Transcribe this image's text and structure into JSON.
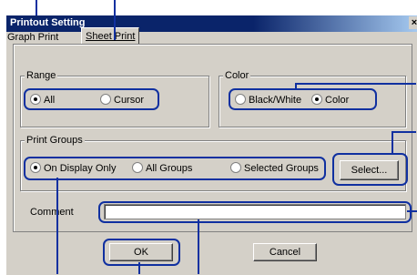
{
  "dialog": {
    "title": "Printout Setting"
  },
  "tabs": [
    {
      "label": "Graph Print"
    },
    {
      "label": "Sheet Print"
    }
  ],
  "range": {
    "legend": "Range",
    "options": [
      {
        "label": "All",
        "selected": true
      },
      {
        "label": "Cursor",
        "selected": false
      }
    ]
  },
  "color": {
    "legend": "Color",
    "options": [
      {
        "label": "Black/White",
        "selected": false
      },
      {
        "label": "Color",
        "selected": true
      }
    ]
  },
  "print_groups": {
    "legend": "Print Groups",
    "options": [
      {
        "label": "On Display Only",
        "selected": true
      },
      {
        "label": "All Groups",
        "selected": false
      },
      {
        "label": "Selected Groups",
        "selected": false
      }
    ],
    "select_label": "Select..."
  },
  "comment": {
    "label": "Comment",
    "value": ""
  },
  "buttons": {
    "ok": "OK",
    "cancel": "Cancel"
  },
  "colors": {
    "titlebar": "#0a246a",
    "callout": "#1030a0",
    "face": "#d4d0c8"
  }
}
